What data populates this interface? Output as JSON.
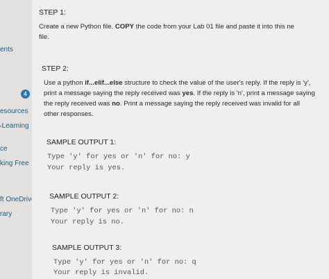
{
  "sidebar": {
    "items": [
      {
        "label": "ents"
      },
      {
        "label": "esources"
      },
      {
        "label": "Learning"
      },
      {
        "label": "ce"
      },
      {
        "label": "king Free"
      },
      {
        "label": "ft OneDrive"
      },
      {
        "label": "rary"
      }
    ],
    "badge_count": "4"
  },
  "step1": {
    "title": "STEP 1:",
    "text_pre": "Create a new Python file. ",
    "text_bold": "COPY",
    "text_post_line1": " the code from your Lab 01 file and paste it into this ne",
    "text_line2": "file."
  },
  "step2": {
    "title": "STEP 2:",
    "line1_pre": "Use a python ",
    "line1_bold": "if...elif...else",
    "line1_post": " structure to check the value of the user's reply. If the reply is 'y',",
    "line2_pre": "print a message saying the reply received was ",
    "line2_bold": "yes",
    "line2_post": ". If the reply is 'n', print a message saying",
    "line3_pre": "the reply received was ",
    "line3_bold": "no",
    "line3_post": ". Print a message saying the reply received was invalid for all",
    "line4": "other responses."
  },
  "samples": [
    {
      "title": "SAMPLE OUTPUT 1:",
      "line1": "Type 'y' for yes or 'n' for no: y",
      "line2": "Your reply is yes."
    },
    {
      "title": "SAMPLE OUTPUT 2:",
      "line1": "Type 'y' for yes or 'n' for no: n",
      "line2": "Your reply is no."
    },
    {
      "title": "SAMPLE OUTPUT 3:",
      "line1": "Type 'y' for yes or 'n' for no: q",
      "line2": "Your reply is invalid."
    }
  ]
}
